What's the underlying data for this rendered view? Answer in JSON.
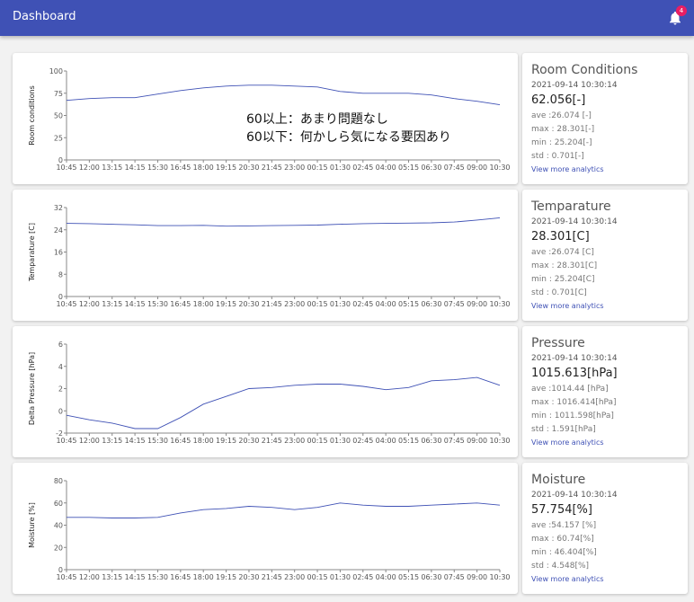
{
  "app": {
    "title": "Dashboard",
    "notification_count": "4"
  },
  "colors": {
    "appbar": "#3f51b5",
    "badge": "#e91e63",
    "series": "#3f51b5",
    "link": "#3f51b5"
  },
  "x_ticks": [
    "10:45",
    "12:00",
    "13:15",
    "14:15",
    "15:30",
    "16:45",
    "18:00",
    "19:15",
    "20:30",
    "21:45",
    "23:00",
    "00:15",
    "01:30",
    "02:45",
    "04:00",
    "05:15",
    "06:30",
    "07:45",
    "09:00",
    "10:30"
  ],
  "panels": [
    {
      "stat": {
        "title": "Room Conditions",
        "timestamp": "2021-09-14 10:30:14",
        "value": "62.056[-]",
        "ave": "ave :26.074 [-]",
        "max": "max : 28.301[-]",
        "min": "min : 25.204[-]",
        "std": "std : 0.701[-]",
        "link": "View more analytics"
      },
      "chart": {
        "ylabel": "Room conditions",
        "annotations": [
          "60以上：あまり問題なし",
          "60以下：何かしら気になる要因あり"
        ]
      }
    },
    {
      "stat": {
        "title": "Temparature",
        "timestamp": "2021-09-14 10:30:14",
        "value": "28.301[C]",
        "ave": "ave :26.074 [C]",
        "max": "max : 28.301[C]",
        "min": "min : 25.204[C]",
        "std": "std : 0.701[C]",
        "link": "View more analytics"
      },
      "chart": {
        "ylabel": "Temparature [C]"
      }
    },
    {
      "stat": {
        "title": "Pressure",
        "timestamp": "2021-09-14 10:30:14",
        "value": "1015.613[hPa]",
        "ave": "ave :1014.44 [hPa]",
        "max": "max : 1016.414[hPa]",
        "min": "min : 1011.598[hPa]",
        "std": "std : 1.591[hPa]",
        "link": "View more analytics"
      },
      "chart": {
        "ylabel": "Delta Pressure [hPa]"
      }
    },
    {
      "stat": {
        "title": "Moisture",
        "timestamp": "2021-09-14 10:30:14",
        "value": "57.754[%]",
        "ave": "ave :54.157 [%]",
        "max": "max : 60.74[%]",
        "min": "min : 46.404[%]",
        "std": "std : 4.548[%]",
        "link": "View more analytics"
      },
      "chart": {
        "ylabel": "Moisture [%]"
      }
    }
  ],
  "chart_data": [
    {
      "type": "line",
      "ylabel": "Room conditions",
      "ylim": [
        0,
        100
      ],
      "yticks": [
        0,
        25,
        50,
        75,
        100
      ],
      "x": [
        "10:45",
        "12:00",
        "13:15",
        "14:15",
        "15:30",
        "16:45",
        "18:00",
        "19:15",
        "20:30",
        "21:45",
        "23:00",
        "00:15",
        "01:30",
        "02:45",
        "04:00",
        "05:15",
        "06:30",
        "07:45",
        "09:00",
        "10:30"
      ],
      "values": [
        67,
        69,
        70,
        70,
        74,
        78,
        81,
        83,
        84,
        84,
        83,
        82,
        77,
        75,
        75,
        75,
        73,
        69,
        66,
        62
      ]
    },
    {
      "type": "line",
      "ylabel": "Temparature [C]",
      "ylim": [
        0,
        32
      ],
      "yticks": [
        0,
        8,
        16,
        24,
        32
      ],
      "x": [
        "10:45",
        "12:00",
        "13:15",
        "14:15",
        "15:30",
        "16:45",
        "18:00",
        "19:15",
        "20:30",
        "21:45",
        "23:00",
        "00:15",
        "01:30",
        "02:45",
        "04:00",
        "05:15",
        "06:30",
        "07:45",
        "09:00",
        "10:30"
      ],
      "values": [
        26.3,
        26.2,
        26.0,
        25.8,
        25.5,
        25.5,
        25.6,
        25.3,
        25.4,
        25.5,
        25.6,
        25.7,
        26.0,
        26.2,
        26.3,
        26.4,
        26.5,
        26.8,
        27.5,
        28.3
      ]
    },
    {
      "type": "line",
      "ylabel": "Delta Pressure [hPa]",
      "ylim": [
        -2,
        6
      ],
      "yticks": [
        -2,
        0,
        2,
        4,
        6
      ],
      "x": [
        "10:45",
        "12:00",
        "13:15",
        "14:15",
        "15:30",
        "16:45",
        "18:00",
        "19:15",
        "20:30",
        "21:45",
        "23:00",
        "00:15",
        "01:30",
        "02:45",
        "04:00",
        "05:15",
        "06:30",
        "07:45",
        "09:00",
        "10:30"
      ],
      "values": [
        -0.4,
        -0.8,
        -1.1,
        -1.6,
        -1.6,
        -0.6,
        0.6,
        1.3,
        2.0,
        2.1,
        2.3,
        2.4,
        2.4,
        2.2,
        1.9,
        2.1,
        2.7,
        2.8,
        3.0,
        2.3
      ]
    },
    {
      "type": "line",
      "ylabel": "Moisture [%]",
      "ylim": [
        0,
        80
      ],
      "yticks": [
        0,
        20,
        40,
        60,
        80
      ],
      "x": [
        "10:45",
        "12:00",
        "13:15",
        "14:15",
        "15:30",
        "16:45",
        "18:00",
        "19:15",
        "20:30",
        "21:45",
        "23:00",
        "00:15",
        "01:30",
        "02:45",
        "04:00",
        "05:15",
        "06:30",
        "07:45",
        "09:00",
        "10:30"
      ],
      "values": [
        47,
        47,
        46.5,
        46.5,
        47,
        51,
        54,
        55,
        57,
        56,
        54,
        56,
        60,
        58,
        57,
        57,
        58,
        59,
        60,
        58
      ]
    }
  ]
}
